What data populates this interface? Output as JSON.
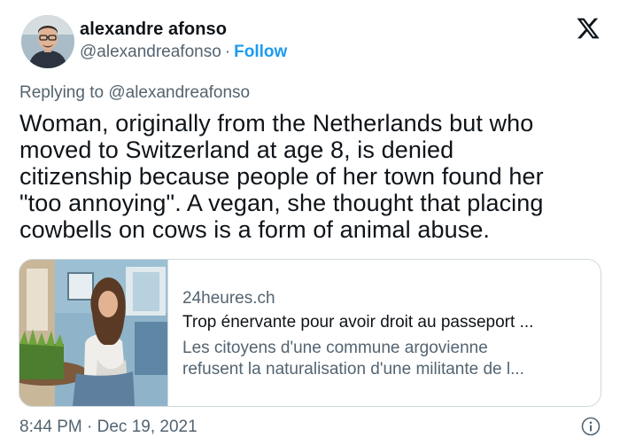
{
  "author": {
    "display_name": "alexandre afonso",
    "handle": "@alexandreafonso",
    "separator": "·",
    "follow_label": "Follow"
  },
  "icons": {
    "logo": "x-logo-icon",
    "info": "info-icon"
  },
  "tweet": {
    "replying_prefix": "Replying to",
    "replying_to": "@alexandreafonso",
    "text_lines": [
      "Woman, originally from the Netherlands but who",
      "moved to Switzerland at age 8, is denied",
      "citizenship because people of her town found her",
      "\"too annoying\". A vegan, she thought that placing",
      "cowbells on cows is a form of animal abuse."
    ],
    "timestamp": "8:44 PM · Dec 19, 2021"
  },
  "link_card": {
    "domain": "24heures.ch",
    "title": "Trop énervante pour avoir droit au passeport ...",
    "description_lines": [
      "Les citoyens d'une commune argovienne",
      "refusent la naturalisation d'une militante de l..."
    ]
  },
  "colors": {
    "text_primary": "#0f1419",
    "text_secondary": "#536471",
    "accent": "#1d9bf0",
    "border": "#cfd9de"
  }
}
